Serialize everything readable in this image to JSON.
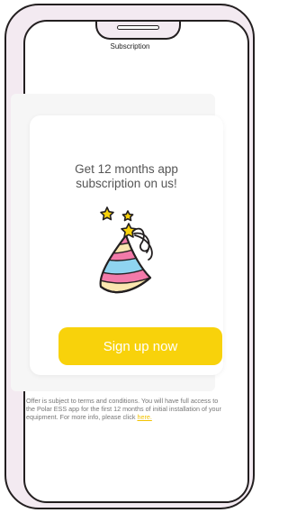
{
  "header": {
    "title": "Subscription"
  },
  "promo": {
    "headline_line1": "Get 12 months app",
    "headline_line2": "subscription on us!",
    "illustration": "party-hat-icon",
    "cta_label": "Sign up now"
  },
  "footer": {
    "disclaimer": "Offer is subject to terms and conditions. You will have full access to the Polar ESS app for the first 12 months of initial installation of your equipment. For more info, please click ",
    "link_label": "here."
  },
  "colors": {
    "accent": "#f8d20b",
    "link": "#f2c200",
    "hat_pink": "#f27aa9",
    "hat_blue": "#8fd4f0",
    "hat_cream": "#fbe6b0",
    "star": "#f8d20b"
  }
}
